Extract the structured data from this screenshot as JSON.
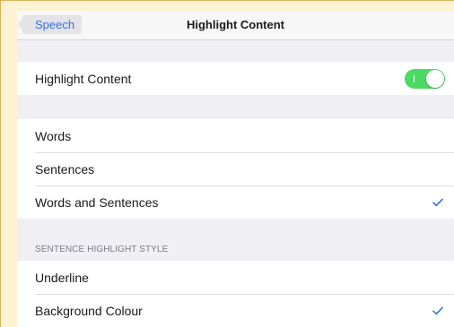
{
  "navbar": {
    "back_label": "Speech",
    "title": "Highlight Content"
  },
  "toggle_group": {
    "label": "Highlight Content",
    "enabled": true
  },
  "highlight_options": {
    "items": [
      {
        "label": "Words",
        "selected": false
      },
      {
        "label": "Sentences",
        "selected": false
      },
      {
        "label": "Words and Sentences",
        "selected": true
      }
    ]
  },
  "sentence_style": {
    "header": "SENTENCE HIGHLIGHT STYLE",
    "items": [
      {
        "label": "Underline",
        "selected": false
      },
      {
        "label": "Background Colour",
        "selected": true
      }
    ]
  },
  "colors": {
    "accent": "#2f73d9",
    "toggle_on": "#4cd964",
    "background": "#efeff4",
    "page_border": "#d8b25a"
  }
}
